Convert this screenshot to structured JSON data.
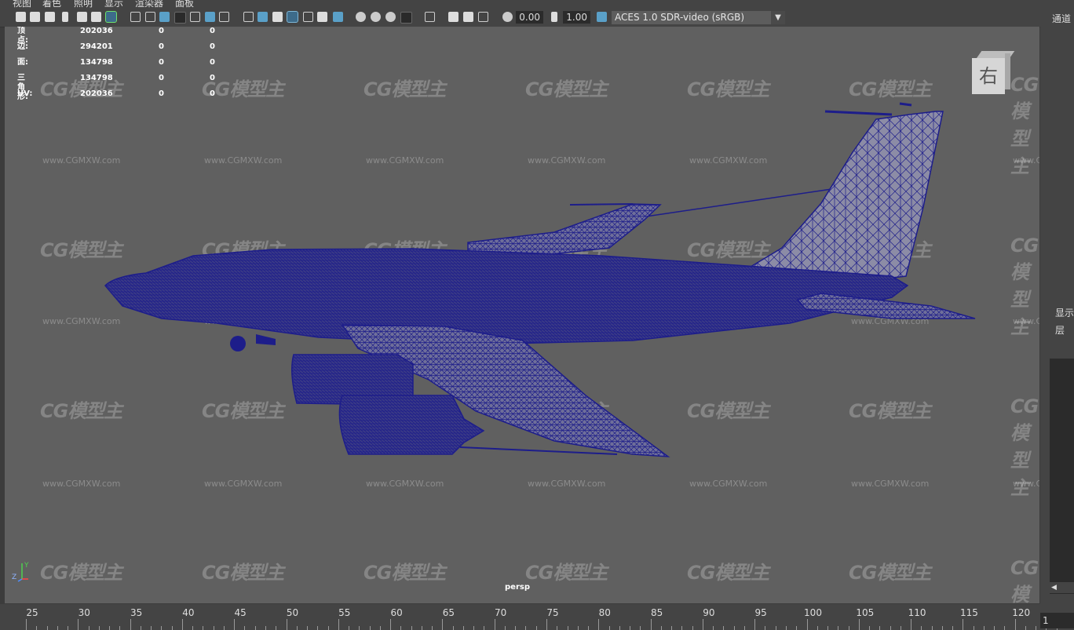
{
  "menu": {
    "items": [
      "视图",
      "着色",
      "照明",
      "显示",
      "渲染器",
      "面板"
    ]
  },
  "toolbar": {
    "exposure": "0.00",
    "gamma": "1.00",
    "color_space": "ACES 1.0 SDR-video (sRGB)"
  },
  "hud": {
    "rows": [
      {
        "label": "顶点:",
        "v1": "202036",
        "v2": "0",
        "v3": "0"
      },
      {
        "label": "边:",
        "v1": "294201",
        "v2": "0",
        "v3": "0"
      },
      {
        "label": "面:",
        "v1": "134798",
        "v2": "0",
        "v3": "0"
      },
      {
        "label": "三角形:",
        "v1": "134798",
        "v2": "0",
        "v3": "0"
      },
      {
        "label": "UV:",
        "v1": "202036",
        "v2": "0",
        "v3": "0"
      }
    ]
  },
  "viewcube": {
    "face_label": "右"
  },
  "viewport": {
    "camera": "persp",
    "wireframe_color": "#1d1d8a",
    "background": "#606060"
  },
  "axis": {
    "y": "Y",
    "z": "Z"
  },
  "watermark": {
    "logo": "CG模型主",
    "url": "www.CGMXW.com"
  },
  "right_panel": {
    "title": "通道",
    "show": "显示",
    "layer": "层"
  },
  "timeline": {
    "labels": [
      "25",
      "30",
      "35",
      "40",
      "45",
      "50",
      "55",
      "60",
      "65",
      "70",
      "75",
      "80",
      "85",
      "90",
      "95",
      "100",
      "105",
      "110",
      "115",
      "120"
    ],
    "current_frame": "1"
  }
}
